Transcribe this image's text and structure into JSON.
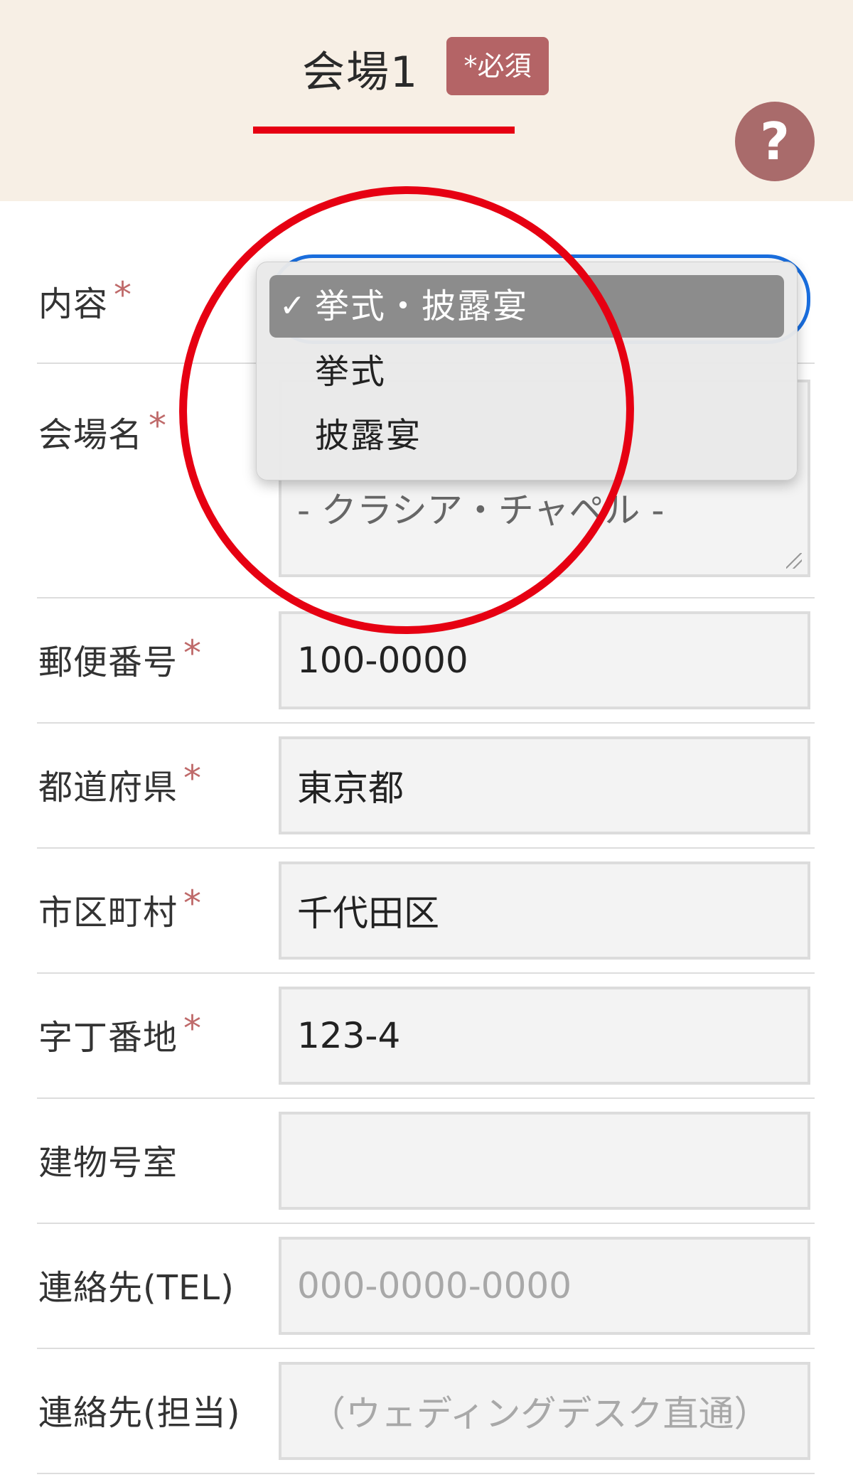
{
  "header": {
    "title": "会場1",
    "required_badge": "*必須",
    "help_label": "?"
  },
  "form": {
    "content": {
      "label": "内容",
      "required_mark": "*",
      "options": [
        "挙式・披露宴",
        "挙式",
        "披露宴"
      ],
      "selected_index": 0,
      "check_mark": "✓"
    },
    "venue_name": {
      "label": "会場名",
      "required_mark": "*",
      "value": "- クラシア・チャペル -"
    },
    "postal_code": {
      "label": "郵便番号",
      "required_mark": "*",
      "value": "100-0000"
    },
    "prefecture": {
      "label": "都道府県",
      "required_mark": "*",
      "value": "東京都"
    },
    "city": {
      "label": "市区町村",
      "required_mark": "*",
      "value": "千代田区"
    },
    "street": {
      "label": "字丁番地",
      "required_mark": "*",
      "value": "123-4"
    },
    "building": {
      "label": "建物号室",
      "value": ""
    },
    "tel": {
      "label": "連絡先(TEL)",
      "placeholder": "000-0000-0000"
    },
    "contact_person": {
      "label": "連絡先(担当)",
      "placeholder": "（ウェディングデスク直通）"
    }
  },
  "colors": {
    "header_bg": "#f7efe5",
    "badge_bg": "#b46466",
    "help_bg": "#a96b6b",
    "underline": "#e60012",
    "select_border": "#1a6fe0",
    "annotation": "#e60012"
  }
}
